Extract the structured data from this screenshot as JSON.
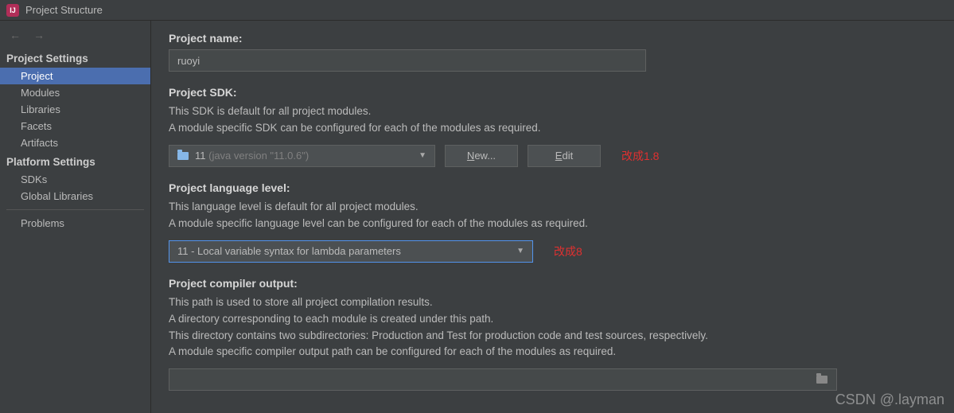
{
  "titlebar": {
    "title": "Project Structure"
  },
  "sidebar": {
    "section1": "Project Settings",
    "items1": [
      "Project",
      "Modules",
      "Libraries",
      "Facets",
      "Artifacts"
    ],
    "section2": "Platform Settings",
    "items2": [
      "SDKs",
      "Global Libraries"
    ],
    "problems": "Problems"
  },
  "project_name": {
    "label": "Project name:",
    "value": "ruoyi"
  },
  "project_sdk": {
    "label": "Project SDK:",
    "desc1": "This SDK is default for all project modules.",
    "desc2": "A module specific SDK can be configured for each of the modules as required.",
    "selected_name": "11",
    "selected_detail": " (java version \"11.0.6\")",
    "new_btn": "New...",
    "edit_btn": "Edit",
    "annotation": "改成1.8"
  },
  "language_level": {
    "label": "Project language level:",
    "desc1": "This language level is default for all project modules.",
    "desc2": "A module specific language level can be configured for each of the modules as required.",
    "selected": "11 - Local variable syntax for lambda parameters",
    "annotation": "改成8"
  },
  "compiler_output": {
    "label": "Project compiler output:",
    "desc1": "This path is used to store all project compilation results.",
    "desc2": "A directory corresponding to each module is created under this path.",
    "desc3": "This directory contains two subdirectories: Production and Test for production code and test sources, respectively.",
    "desc4": "A module specific compiler output path can be configured for each of the modules as required.",
    "value": ""
  },
  "watermark": "CSDN @.layman"
}
